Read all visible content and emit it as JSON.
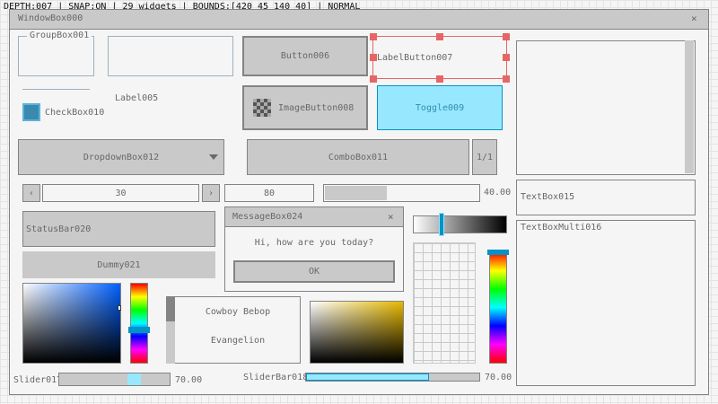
{
  "status_line": "DEPTH:007 | SNAP:ON | 29 widgets | BOUNDS:[420 45 140 40] | NORMAL",
  "window": {
    "title": "WindowBox000",
    "close": "×"
  },
  "groupbox": {
    "label": "GroupBox001"
  },
  "label": "Label005",
  "checkbox": {
    "label": "CheckBox010",
    "checked": true
  },
  "buttons": {
    "button": "Button006",
    "label_button": "LabelButton007",
    "image_button": "ImageButton008",
    "toggle": "Toggle009",
    "dummy": "Dummy021"
  },
  "dropdown": {
    "label": "DropdownBox012"
  },
  "combobox": {
    "label": "ComboBox011",
    "counter": "1/1"
  },
  "spinner": {
    "value": "30",
    "left_arrow": "‹",
    "right_arrow": "›"
  },
  "valuebox": {
    "value": "80"
  },
  "progressbar": {
    "value_text": "40.00",
    "fraction": 0.4
  },
  "textbox": {
    "label": "TextBox015"
  },
  "textbox_multi": {
    "label": "TextBoxMulti016"
  },
  "statusbar": {
    "label": "StatusBar020"
  },
  "messagebox": {
    "title": "MessageBox024",
    "close": "×",
    "message": "Hi, how are you today?",
    "ok": "OK"
  },
  "listview": {
    "items": [
      "Cowboy Bebop",
      "Evangelion"
    ]
  },
  "slider": {
    "label": "Slider017",
    "value_text": "70.00",
    "fraction": 0.7
  },
  "sliderbar": {
    "label": "SliderBar018",
    "value_text": "70.00",
    "fraction": 0.7
  },
  "colors": {
    "accent": "#97e8ff",
    "accent_border": "#0492c7",
    "selection": "#e66666",
    "panel": "#c9c9c9",
    "border": "#838383"
  }
}
